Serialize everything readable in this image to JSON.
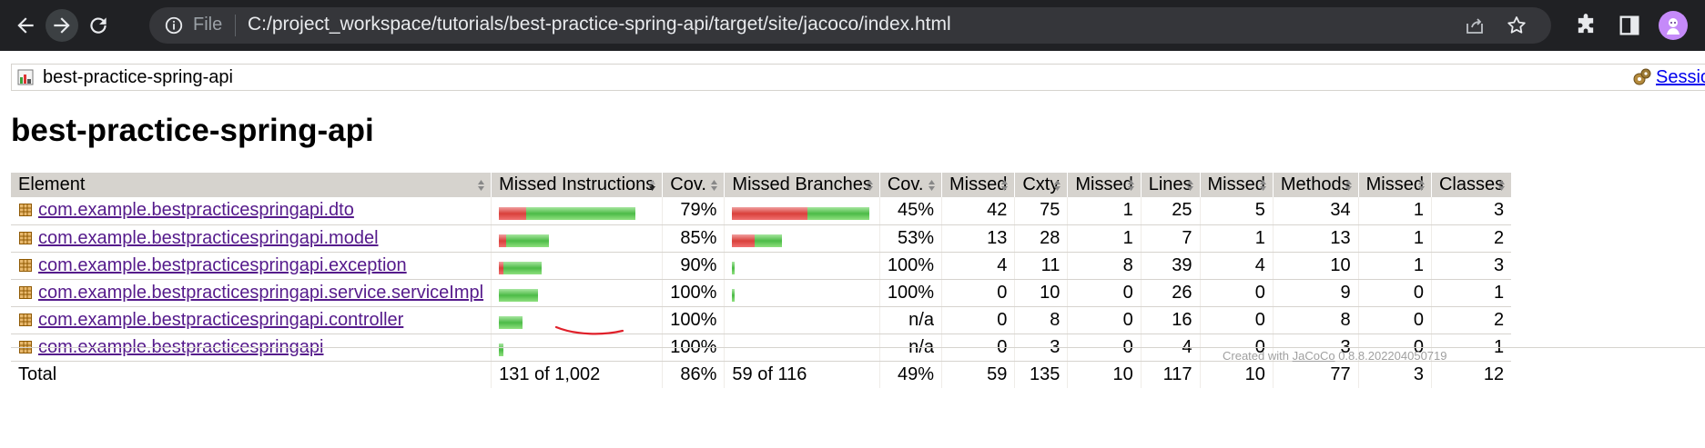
{
  "browser": {
    "file_label": "File",
    "url": "C:/project_workspace/tutorials/best-practice-spring-api/target/site/jacoco/index.html"
  },
  "breadcrumb": {
    "report": "best-practice-spring-api",
    "sessions": "Sessions"
  },
  "page_title": "best-practice-spring-api",
  "table": {
    "headers": [
      "Element",
      "Missed Instructions",
      "Cov.",
      "Missed Branches",
      "Cov.",
      "Missed",
      "Cxty",
      "Missed",
      "Lines",
      "Missed",
      "Methods",
      "Missed",
      "Classes"
    ],
    "rows": [
      {
        "name": "com.example.bestpracticespringapi.dto",
        "instr_cov": "79%",
        "branch_cov": "45%",
        "missed_cxty": "42",
        "cxty": "75",
        "missed_lines": "1",
        "lines": "25",
        "missed_methods": "5",
        "methods": "34",
        "missed_classes": "1",
        "classes": "3",
        "instr_bar": {
          "missed": 0.2,
          "covered": 0.8
        },
        "branch_bar": {
          "missed": 0.55,
          "covered": 0.45
        }
      },
      {
        "name": "com.example.bestpracticespringapi.model",
        "instr_cov": "85%",
        "branch_cov": "53%",
        "missed_cxty": "13",
        "cxty": "28",
        "missed_lines": "1",
        "lines": "7",
        "missed_methods": "1",
        "methods": "13",
        "missed_classes": "1",
        "classes": "2",
        "instr_bar": {
          "missed": 0.053,
          "covered": 0.313
        },
        "branch_bar": {
          "missed": 0.167,
          "covered": 0.2
        }
      },
      {
        "name": "com.example.bestpracticespringapi.exception",
        "instr_cov": "90%",
        "branch_cov": "100%",
        "missed_cxty": "4",
        "cxty": "11",
        "missed_lines": "8",
        "lines": "39",
        "missed_methods": "4",
        "methods": "10",
        "missed_classes": "1",
        "classes": "3",
        "instr_bar": {
          "missed": 0.033,
          "covered": 0.28
        },
        "branch_bar": {
          "missed": 0.0,
          "covered": 0.02
        }
      },
      {
        "name": "com.example.bestpracticespringapi.service.serviceImpl",
        "instr_cov": "100%",
        "branch_cov": "100%",
        "missed_cxty": "0",
        "cxty": "10",
        "missed_lines": "0",
        "lines": "26",
        "missed_methods": "0",
        "methods": "9",
        "missed_classes": "0",
        "classes": "1",
        "instr_bar": {
          "missed": 0.0,
          "covered": 0.287
        },
        "branch_bar": {
          "missed": 0.0,
          "covered": 0.02
        }
      },
      {
        "name": "com.example.bestpracticespringapi.controller",
        "instr_cov": "100%",
        "branch_cov": "n/a",
        "missed_cxty": "0",
        "cxty": "8",
        "missed_lines": "0",
        "lines": "16",
        "missed_methods": "0",
        "methods": "8",
        "missed_classes": "0",
        "classes": "2",
        "instr_bar": {
          "missed": 0.0,
          "covered": 0.173
        },
        "branch_bar": {
          "missed": 0.0,
          "covered": 0.0
        }
      },
      {
        "name": "com.example.bestpracticespringapi",
        "instr_cov": "100%",
        "branch_cov": "n/a",
        "missed_cxty": "0",
        "cxty": "3",
        "missed_lines": "0",
        "lines": "4",
        "missed_methods": "0",
        "methods": "3",
        "missed_classes": "0",
        "classes": "1",
        "instr_bar": {
          "missed": 0.0,
          "covered": 0.033
        },
        "branch_bar": {
          "missed": 0.0,
          "covered": 0.0
        }
      }
    ],
    "total": {
      "label": "Total",
      "instr": "131 of 1,002",
      "instr_cov": "86%",
      "branch": "59 of 116",
      "branch_cov": "49%",
      "missed_cxty": "59",
      "cxty": "135",
      "missed_lines": "10",
      "lines": "117",
      "missed_methods": "10",
      "methods": "77",
      "missed_classes": "3",
      "classes": "12"
    }
  },
  "footer": {
    "prefix": "Created with",
    "link": "JaCoCo",
    "version": "0.8.8.202204050719"
  },
  "colors": {
    "missed": "#d9403a",
    "covered": "#4cbb47",
    "header_bg": "#d6d3ce"
  }
}
